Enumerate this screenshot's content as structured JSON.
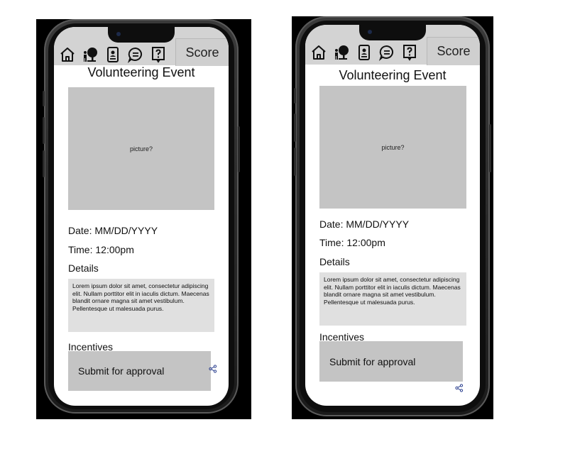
{
  "screens": [
    {
      "score_label": "Score",
      "title": "Volunteering Event",
      "picture_label": "picture?",
      "date": "Date: MM/DD/YYYY",
      "time": "Time: 12:00pm",
      "details_heading": "Details",
      "details_text": "Lorem ipsum dolor sit amet, consectetur adipiscing elit. Nullam porttitor elit in iaculis dictum. Maecenas blandit ornare magna sit amet vestibulum. Pellentesque ut malesuada purus.",
      "incentives_heading": "Incentives",
      "submit_label": "Submit for approval"
    },
    {
      "score_label": "Score",
      "title": "Volunteering Event",
      "picture_label": "picture?",
      "date": "Date: MM/DD/YYYY",
      "time": "Time: 12:00pm",
      "details_heading": "Details",
      "details_text": "Lorem ipsum dolor sit amet, consectetur adipiscing elit. Nullam porttitor elit in iaculis dictum. Maecenas blandit ornare magna sit amet vestibulum. Pellentesque ut malesuada purus.",
      "incentives_heading": "Incentives",
      "submit_label": "Submit for approval"
    }
  ],
  "icons": [
    "home-icon",
    "person-tree-icon",
    "contact-card-icon",
    "chat-icon",
    "help-icon",
    "share-icon"
  ]
}
